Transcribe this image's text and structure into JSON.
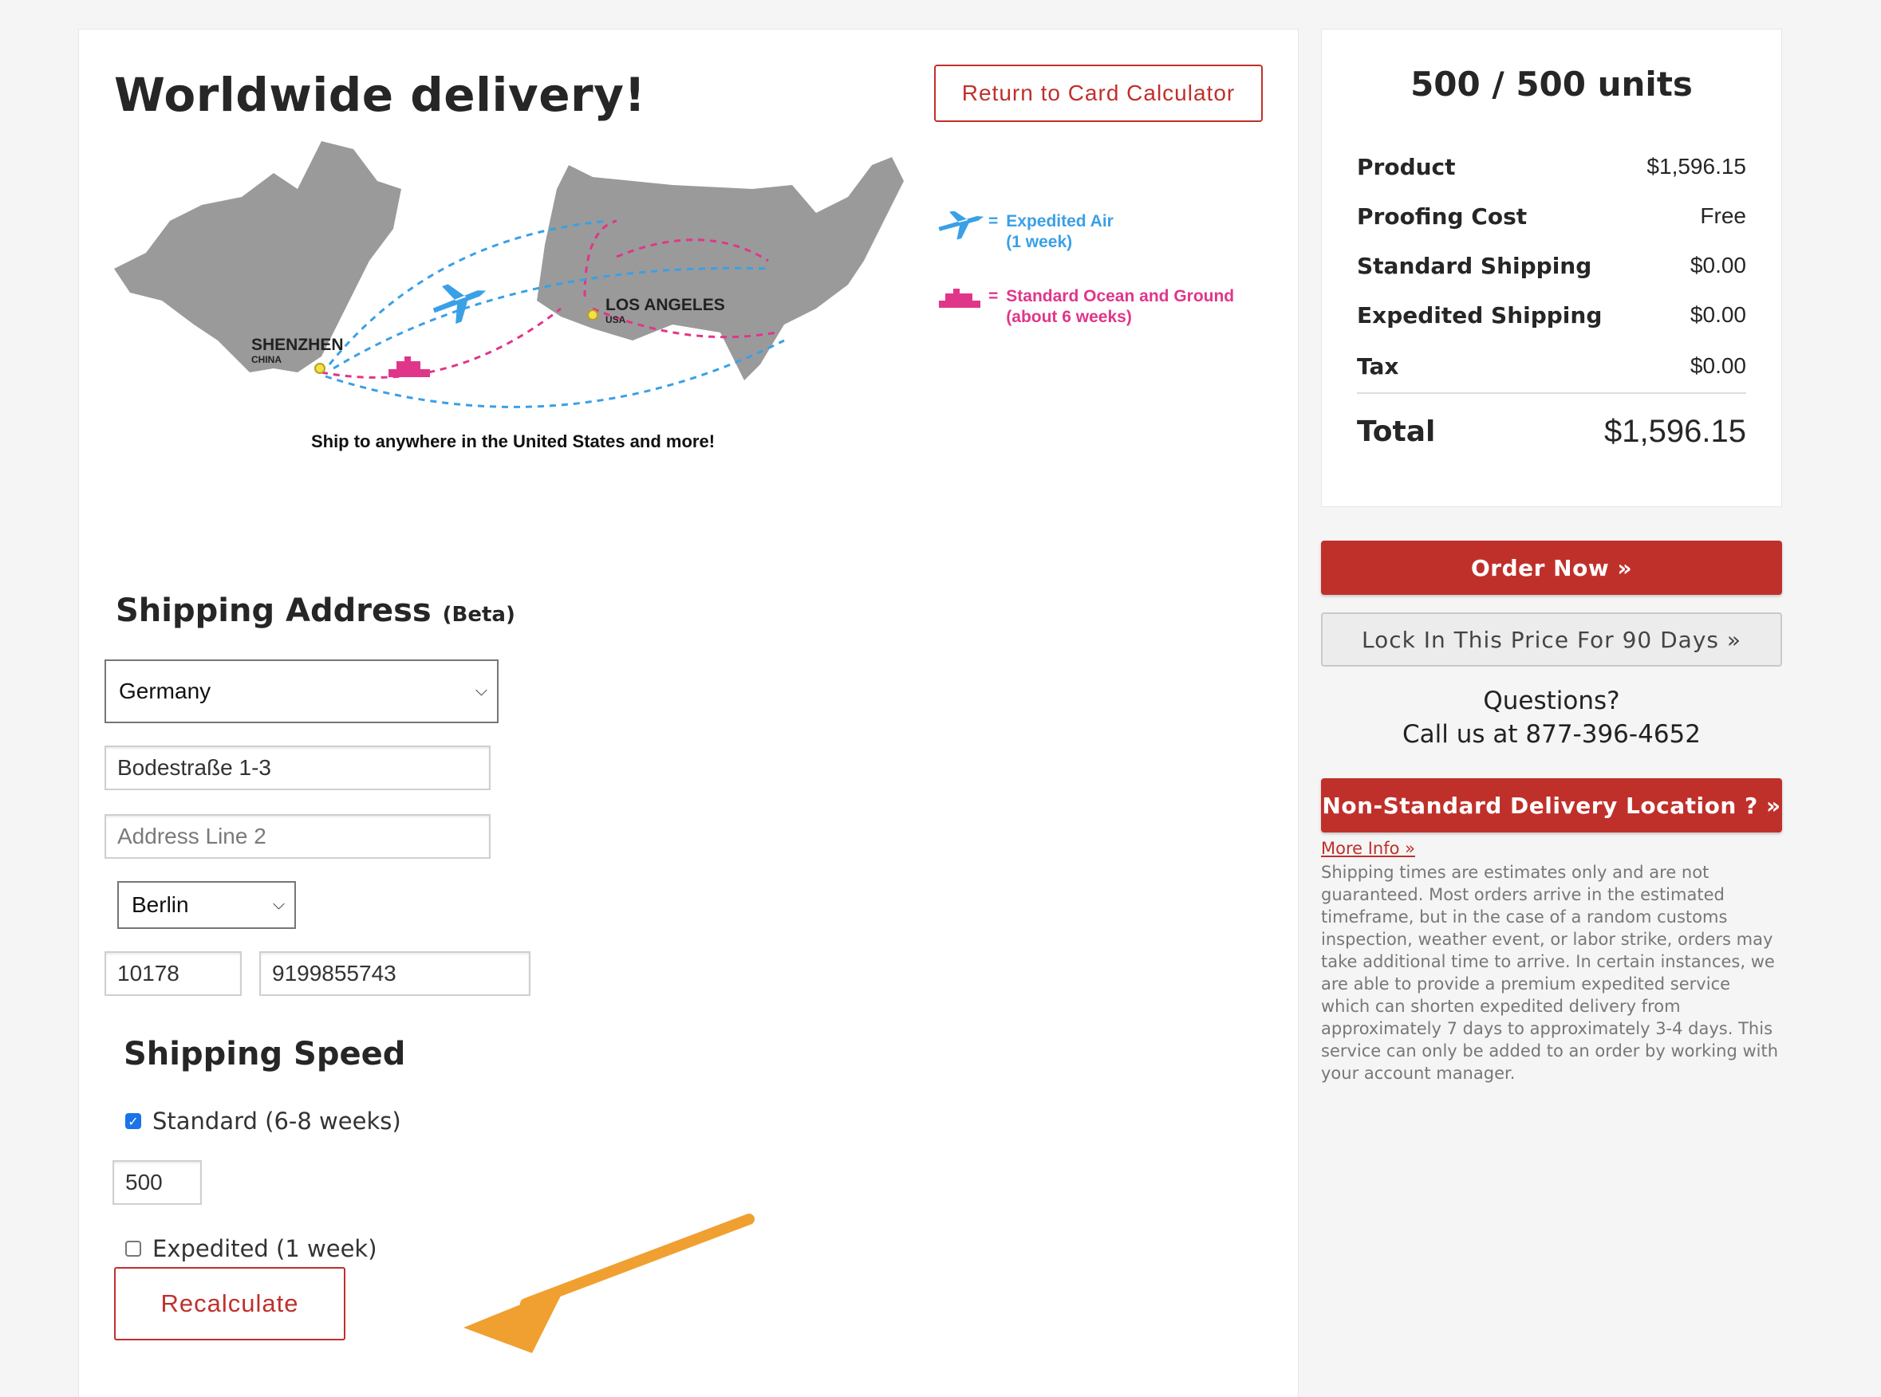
{
  "header": {
    "title": "Worldwide delivery!",
    "return_label": "Return to Card Calculator"
  },
  "map": {
    "origin_city": "SHENZHEN",
    "origin_country": "CHINA",
    "dest_city": "LOS ANGELES",
    "dest_country": "USA",
    "caption": "Ship to anywhere in the United States and more!",
    "legend_air_line1": "Expedited Air",
    "legend_air_line2": "(1 week)",
    "legend_ocean_line1": "Standard Ocean and Ground",
    "legend_ocean_line2": "(about 6 weeks)",
    "equals": "=",
    "air_color": "#3aa0e6",
    "ocean_color": "#e0368a"
  },
  "address": {
    "title": "Shipping Address",
    "beta": "(Beta)",
    "country": "Germany",
    "line1": "Bodestraße 1-3",
    "line2_placeholder": "Address Line 2",
    "city": "Berlin",
    "zip": "10178",
    "phone": "9199855743"
  },
  "speed": {
    "title": "Shipping Speed",
    "standard_label": "Standard (6-8 weeks)",
    "standard_qty": "500",
    "expedited_label": "Expedited (1 week)",
    "recalc_label": "Recalculate"
  },
  "summary": {
    "units": "500 / 500 units",
    "rows": [
      {
        "label": "Product",
        "value": "$1,596.15"
      },
      {
        "label": "Proofing Cost",
        "value": "Free"
      },
      {
        "label": "Standard Shipping",
        "value": "$0.00"
      },
      {
        "label": "Expedited Shipping",
        "value": "$0.00"
      },
      {
        "label": "Tax",
        "value": "$0.00"
      }
    ],
    "total_label": "Total",
    "total_value": "$1,596.15"
  },
  "actions": {
    "order_now": "Order Now »",
    "lock_price": "Lock In This Price For 90 Days »",
    "questions_line1": "Questions?",
    "questions_line2": "Call us at 877-396-4652",
    "non_standard": "Non-Standard Delivery Location ? »",
    "more_info": "More Info »",
    "disclaimer": "Shipping times are estimates only and are not guaranteed. Most orders arrive in the estimated timeframe, but in the case of a random customs inspection, weather event, or labor strike, orders may take additional time to arrive. In certain instances, we are able to provide a premium expedited service which can shorten expedited delivery from approximately 7 days to approximately 3-4 days. This service can only be added to an order by working with your account manager."
  },
  "colors": {
    "brand_red": "#c0302b",
    "arrow": "#f0a030"
  }
}
